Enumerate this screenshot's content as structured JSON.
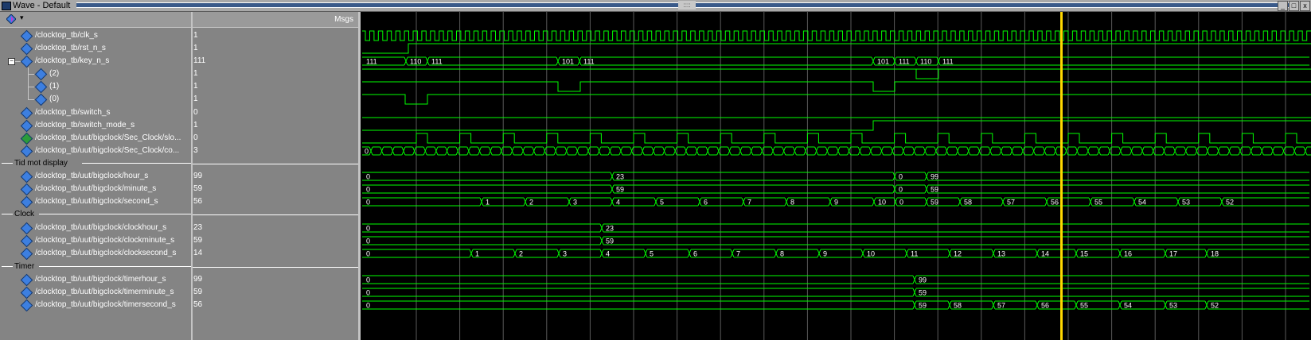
{
  "window": {
    "title": "Wave - Default",
    "buttons": [
      "_",
      "□",
      "x"
    ]
  },
  "panes": {
    "values_header": "Msgs"
  },
  "signals": [
    {
      "id": "clk",
      "name": "/clocktop_tb/clk_s",
      "value": "1",
      "kind": "bit",
      "indent": 0
    },
    {
      "id": "rst",
      "name": "/clocktop_tb/rst_n_s",
      "value": "1",
      "kind": "bit",
      "indent": 0
    },
    {
      "id": "key",
      "name": "/clocktop_tb/key_n_s",
      "value": "111",
      "kind": "bus",
      "indent": 0,
      "expanded": true
    },
    {
      "id": "key2",
      "name": "(2)",
      "value": "1",
      "kind": "bit",
      "indent": 1
    },
    {
      "id": "key1",
      "name": "(1)",
      "value": "1",
      "kind": "bit",
      "indent": 1
    },
    {
      "id": "key0",
      "name": "(0)",
      "value": "1",
      "kind": "bit",
      "indent": 1
    },
    {
      "id": "switch",
      "name": "/clocktop_tb/switch_s",
      "value": "0",
      "kind": "bit",
      "indent": 0
    },
    {
      "id": "switchmode",
      "name": "/clocktop_tb/switch_mode_s",
      "value": "1",
      "kind": "bit",
      "indent": 0
    },
    {
      "id": "slow",
      "name": "/clocktop_tb/uut/bigclock/Sec_Clock/slo...",
      "value": "0",
      "kind": "bit",
      "indent": 0,
      "arrow": true
    },
    {
      "id": "count",
      "name": "/clocktop_tb/uut/bigclock/Sec_Clock/co...",
      "value": "3",
      "kind": "bus",
      "indent": 0
    },
    {
      "id": "g1",
      "group": true,
      "name": "Tid mot display"
    },
    {
      "id": "hour",
      "name": "/clocktop_tb/uut/bigclock/hour_s",
      "value": "99",
      "kind": "bus",
      "indent": 0
    },
    {
      "id": "minute",
      "name": "/clocktop_tb/uut/bigclock/minute_s",
      "value": "59",
      "kind": "bus",
      "indent": 0
    },
    {
      "id": "second",
      "name": "/clocktop_tb/uut/bigclock/second_s",
      "value": "56",
      "kind": "bus",
      "indent": 0
    },
    {
      "id": "g2",
      "group": true,
      "name": "Clock"
    },
    {
      "id": "chour",
      "name": "/clocktop_tb/uut/bigclock/clockhour_s",
      "value": "23",
      "kind": "bus",
      "indent": 0
    },
    {
      "id": "cminute",
      "name": "/clocktop_tb/uut/bigclock/clockminute_s",
      "value": "59",
      "kind": "bus",
      "indent": 0
    },
    {
      "id": "csecond",
      "name": "/clocktop_tb/uut/bigclock/clocksecond_s",
      "value": "14",
      "kind": "bus",
      "indent": 0
    },
    {
      "id": "g3",
      "group": true,
      "name": "Timer"
    },
    {
      "id": "thour",
      "name": "/clocktop_tb/uut/bigclock/timerhour_s",
      "value": "99",
      "kind": "bus",
      "indent": 0
    },
    {
      "id": "tminute",
      "name": "/clocktop_tb/uut/bigclock/timerminute_s",
      "value": "59",
      "kind": "bus",
      "indent": 0
    },
    {
      "id": "tsecond",
      "name": "/clocktop_tb/uut/bigclock/timersecond_s",
      "value": "56",
      "kind": "bus",
      "indent": 0
    }
  ],
  "waves": {
    "key": [
      "111",
      "110",
      "111",
      "101",
      "111",
      "101",
      "111",
      "110",
      "111"
    ],
    "count_start": "0",
    "hour": [
      "0",
      "23",
      "0",
      "99"
    ],
    "minute": [
      "0",
      "59",
      "0",
      "59"
    ],
    "second": [
      "0",
      "1",
      "2",
      "3",
      "4",
      "5",
      "6",
      "7",
      "8",
      "9",
      "10",
      "0",
      "59",
      "58",
      "57",
      "56",
      "55",
      "54",
      "53",
      "52"
    ],
    "chour": [
      "0",
      "23"
    ],
    "cminute": [
      "0",
      "59"
    ],
    "csecond": [
      "0",
      "1",
      "2",
      "3",
      "4",
      "5",
      "6",
      "7",
      "8",
      "9",
      "10",
      "11",
      "12",
      "13",
      "14",
      "15",
      "16",
      "17",
      "18"
    ],
    "thour": [
      "0",
      "99"
    ],
    "tminute": [
      "0",
      "59"
    ],
    "tsecond": [
      "0",
      "59",
      "58",
      "57",
      "56",
      "55",
      "54",
      "53",
      "52"
    ]
  },
  "colors": {
    "wave": "#00ff00",
    "cursor": "#ffd700",
    "grid": "#5a5a5a",
    "pane_bg": "#848484",
    "signal_icon": "#3d7fe0"
  }
}
